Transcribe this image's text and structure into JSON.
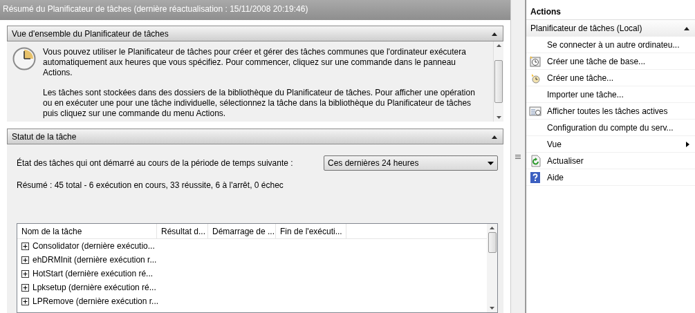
{
  "title_bar": {
    "title": "Résumé du Planificateur de tâches (dernière réactualisation : 15/11/2008 20:19:46)"
  },
  "overview": {
    "title": "Vue d'ensemble du Planificateur de tâches",
    "expanded": true,
    "paragraphs": [
      "Vous pouvez utiliser le Planificateur de tâches pour créer et gérer des tâches communes que l'ordinateur exécutera automatiquement aux heures que vous spécifiez. Pour commencer, cliquez sur une commande dans le panneau Actions.",
      "Les tâches sont stockées dans des dossiers de la bibliothèque du Planificateur de tâches. Pour afficher une opération ou en exécuter une pour une tâche individuelle, sélectionnez la tâche dans la bibliothèque du Planificateur de tâches puis cliquez sur une commande du menu Actions."
    ]
  },
  "status": {
    "title": "Statut de la tâche",
    "expanded": true,
    "period_label": "État des tâches qui ont démarré au cours de la période de temps suivante :",
    "period": {
      "value": "Ces dernières 24 heures"
    },
    "summary": "Résumé : 45 total - 6 exécution en cours, 33 réussite, 6 à l'arrêt, 0 échec",
    "table": {
      "columns": [
        "Nom de la tâche",
        "Résultat d...",
        "Démarrage de ...",
        "Fin de l'exécuti..."
      ],
      "rows": [
        {
          "name": "Consolidator (dernière exécutio...",
          "expanded": false
        },
        {
          "name": "ehDRMInit (dernière exécution r...",
          "expanded": false
        },
        {
          "name": "HotStart (dernière exécution ré...",
          "expanded": false
        },
        {
          "name": "Lpksetup (dernière exécution ré...",
          "expanded": false
        },
        {
          "name": "LPRemove (dernière exécution r...",
          "expanded": false
        }
      ]
    }
  },
  "actions": {
    "title": "Actions",
    "group": {
      "title": "Planificateur de tâches (Local)",
      "expanded": true
    },
    "items": [
      {
        "kind": "plain",
        "label": "Se connecter à un autre ordinateu..."
      },
      {
        "kind": "basic-task",
        "label": "Créer une tâche de base..."
      },
      {
        "kind": "task",
        "label": "Créer une tâche..."
      },
      {
        "kind": "plain",
        "label": "Importer une tâche..."
      },
      {
        "kind": "active-tasks",
        "label": "Afficher toutes les tâches actives"
      },
      {
        "kind": "plain",
        "label": "Configuration du compte du serv..."
      },
      {
        "kind": "submenu",
        "label": "Vue"
      },
      {
        "kind": "refresh",
        "label": "Actualiser"
      },
      {
        "kind": "help",
        "label": "Aide"
      }
    ]
  }
}
